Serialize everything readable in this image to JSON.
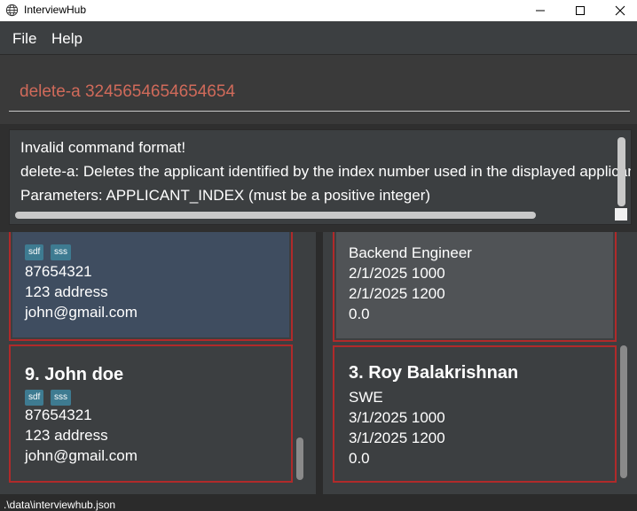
{
  "window": {
    "title": "InterviewHub",
    "icon": "globe-icon",
    "controls": [
      "minimize-icon",
      "maximize-icon",
      "close-icon"
    ]
  },
  "menu": {
    "file": "File",
    "help": "Help"
  },
  "command": {
    "value": "delete-a 3245654654654654"
  },
  "result": {
    "lines": [
      "Invalid command format!",
      "delete-a: Deletes the applicant identified by the index number used in the displayed applicant list.",
      "Parameters: APPLICANT_INDEX (must be a positive integer)"
    ]
  },
  "applicants": {
    "partial_card": {
      "tags": [
        "sdf",
        "sss"
      ],
      "phone": "87654321",
      "address": "123 address",
      "email": "john@gmail.com"
    },
    "card": {
      "title": "9.  John doe",
      "tags": [
        "sdf",
        "sss"
      ],
      "phone": "87654321",
      "address": "123 address",
      "email": "john@gmail.com"
    }
  },
  "interviews": {
    "partial_card": {
      "role": "Backend Engineer",
      "start": "2/1/2025 1000",
      "end": "2/1/2025 1200",
      "score": "0.0"
    },
    "card": {
      "title": "3.  Roy Balakrishnan",
      "role": "SWE",
      "start": "3/1/2025 1000",
      "end": "3/1/2025 1200",
      "score": "0.0"
    }
  },
  "status": {
    "path": ".\\data\\interviewhub.json"
  },
  "colors": {
    "command_text": "#d06a5a",
    "card_border": "#b02a2a",
    "selected_card": "#3f4d60",
    "tag": "#3e7b91"
  }
}
